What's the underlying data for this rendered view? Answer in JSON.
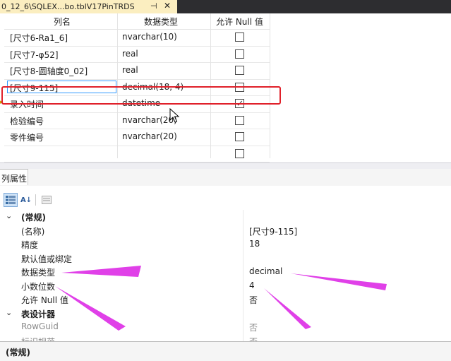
{
  "document_tab": {
    "title": "0_12_6\\SQLEX...bo.tblV17PinTRDS",
    "pin_icon": "pin-icon",
    "close_icon": "close-icon"
  },
  "designer": {
    "columns": [
      "列名",
      "数据类型",
      "允许 Null 值"
    ],
    "rows": [
      {
        "name": "[尺寸6-Ra1_6]",
        "type": "nvarchar(10)",
        "allow_null": false
      },
      {
        "name": "[尺寸7-φ52]",
        "type": "real",
        "allow_null": false
      },
      {
        "name": "[尺寸8-圆轴度0_02]",
        "type": "real",
        "allow_null": false
      },
      {
        "name": "[尺寸9-115]",
        "type": "decimal(18, 4)",
        "allow_null": false,
        "editing": true
      },
      {
        "name": "录入时间",
        "type": "datetime",
        "allow_null": true
      },
      {
        "name": "检验编号",
        "type": "nvarchar(20)",
        "allow_null": false
      },
      {
        "name": "零件编号",
        "type": "nvarchar(20)",
        "allow_null": false
      },
      {
        "name": "",
        "type": "",
        "allow_null": false
      }
    ],
    "highlight_color": "#e0202a"
  },
  "properties": {
    "tab_label": "列属性",
    "toolbar": [
      "categorized-icon",
      "alphabetical-icon",
      "property-pages-icon"
    ],
    "alpha_label": "A↓",
    "rows": [
      {
        "kind": "category",
        "label": "(常规)",
        "expanded": true
      },
      {
        "kind": "prop",
        "label": "(名称)",
        "value": "[尺寸9-115]"
      },
      {
        "kind": "prop",
        "label": "精度",
        "value": "18"
      },
      {
        "kind": "prop",
        "label": "默认值或绑定",
        "value": ""
      },
      {
        "kind": "prop",
        "label": "数据类型",
        "value": "decimal"
      },
      {
        "kind": "prop",
        "label": "小数位数",
        "value": "4"
      },
      {
        "kind": "prop",
        "label": "允许 Null 值",
        "value": "否"
      },
      {
        "kind": "category",
        "label": "表设计器",
        "expanded": true
      },
      {
        "kind": "prop",
        "label": "RowGuid",
        "value": "否",
        "grey": true
      },
      {
        "kind": "prop",
        "label": "标识规范",
        "value": "否",
        "grey": true
      }
    ],
    "description": "(常规)",
    "annotation_color": "#e040e8"
  }
}
